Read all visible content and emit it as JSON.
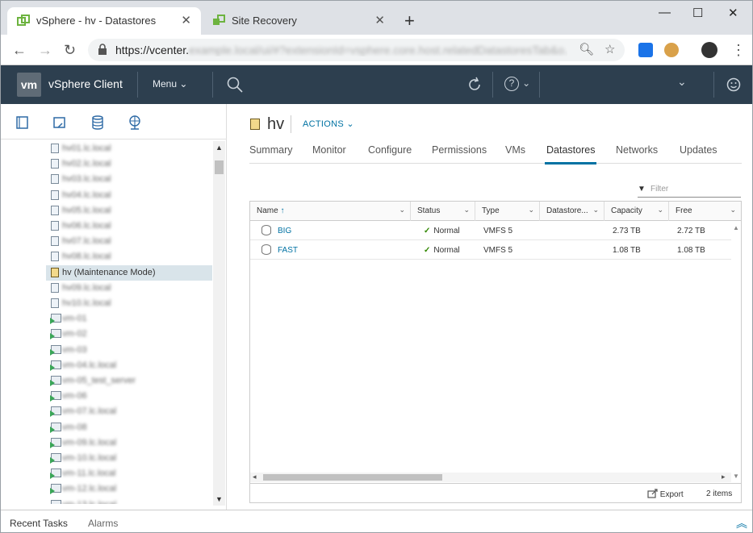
{
  "browser": {
    "tabs": [
      {
        "title": "vSphere - hv - Datastores"
      },
      {
        "title": "Site Recovery"
      }
    ],
    "new_tab": "+",
    "window_controls": {
      "minimize": "—",
      "maximize": "☐",
      "close": "✕"
    },
    "url_host": "https://vcenter.",
    "url_rest": "example.local/ui/#?extensionId=vsphere.core.host.relatedDatastoresTab&o..."
  },
  "header": {
    "logo": "vm",
    "app_name": "vSphere Client",
    "menu_label": "Menu",
    "help": "?"
  },
  "nav_tabs": [
    "hosts-clusters",
    "vms-templates",
    "storage",
    "networking"
  ],
  "tree": {
    "items": [
      {
        "label": "hv01.lc.local",
        "type": "host"
      },
      {
        "label": "hv02.lc.local",
        "type": "host"
      },
      {
        "label": "hv03.lc.local",
        "type": "host"
      },
      {
        "label": "hv04.lc.local",
        "type": "host"
      },
      {
        "label": "hv05.lc.local",
        "type": "host"
      },
      {
        "label": "hv06.lc.local",
        "type": "host"
      },
      {
        "label": "hv07.lc.local",
        "type": "host"
      },
      {
        "label": "hv08.lc.local",
        "type": "host"
      },
      {
        "label": "hv (Maintenance Mode)",
        "type": "host-maint",
        "selected": true
      },
      {
        "label": "hv09.lc.local",
        "type": "host"
      },
      {
        "label": "hv10.lc.local",
        "type": "host"
      },
      {
        "label": "vm-01",
        "type": "vm"
      },
      {
        "label": "vm-02",
        "type": "vm"
      },
      {
        "label": "vm-03",
        "type": "vm"
      },
      {
        "label": "vm-04.lc.local",
        "type": "vm"
      },
      {
        "label": "vm-05_test_server",
        "type": "vm"
      },
      {
        "label": "vm-06",
        "type": "vm"
      },
      {
        "label": "vm-07.lc.local",
        "type": "vm"
      },
      {
        "label": "vm-08",
        "type": "vm"
      },
      {
        "label": "vm-09.lc.local",
        "type": "vm"
      },
      {
        "label": "vm-10.lc.local",
        "type": "vm"
      },
      {
        "label": "vm-11.lc.local",
        "type": "vm"
      },
      {
        "label": "vm-12.lc.local",
        "type": "vm"
      },
      {
        "label": "vm-13.lc.local",
        "type": "vm"
      }
    ]
  },
  "main": {
    "title": "hv",
    "actions_label": "ACTIONS",
    "tabs": [
      {
        "label": "Summary"
      },
      {
        "label": "Monitor"
      },
      {
        "label": "Configure"
      },
      {
        "label": "Permissions"
      },
      {
        "label": "VMs"
      },
      {
        "label": "Datastores",
        "selected": true
      },
      {
        "label": "Networks"
      },
      {
        "label": "Updates"
      }
    ],
    "filter_placeholder": "Filter",
    "grid": {
      "columns": [
        "Name",
        "Status",
        "Type",
        "Datastore...",
        "Capacity",
        "Free"
      ],
      "rows": [
        {
          "name": "BIG",
          "status": "Normal",
          "type": "VMFS 5",
          "cluster": "",
          "capacity": "2.73 TB",
          "free": "2.72 TB"
        },
        {
          "name": "FAST",
          "status": "Normal",
          "type": "VMFS 5",
          "cluster": "",
          "capacity": "1.08 TB",
          "free": "1.08 TB"
        }
      ],
      "export_label": "Export",
      "count_label": "2 items"
    }
  },
  "bottom": {
    "recent_tasks": "Recent Tasks",
    "alarms": "Alarms"
  },
  "colors": {
    "header_bg": "#2d3f4f",
    "accent": "#0072a3",
    "ok_green": "#318700",
    "selected_row": "#d9e4ea"
  }
}
